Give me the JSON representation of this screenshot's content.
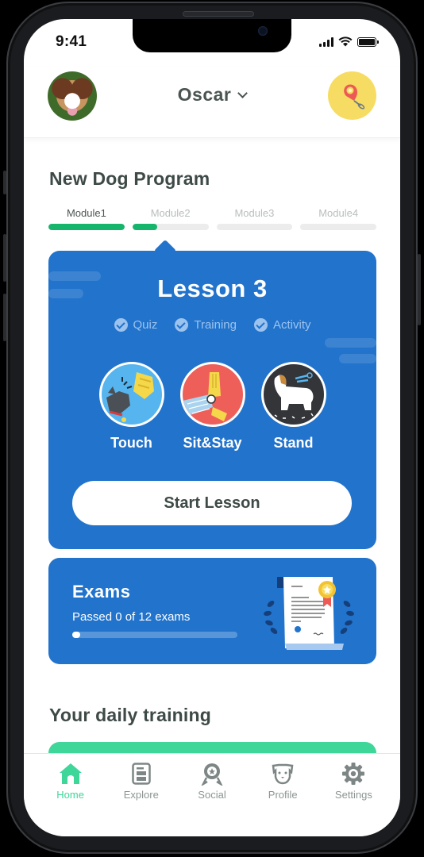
{
  "status_bar": {
    "time": "9:41"
  },
  "header": {
    "dog_name": "Oscar",
    "avatar_alt": "dog-avatar",
    "clicker_icon": "clicker-icon"
  },
  "program": {
    "title": "New Dog Program",
    "modules": [
      {
        "label": "Module1",
        "progress": 1.0,
        "active": true
      },
      {
        "label": "Module2",
        "progress": 0.33,
        "active": false
      },
      {
        "label": "Module3",
        "progress": 0.0,
        "active": false
      },
      {
        "label": "Module4",
        "progress": 0.0,
        "active": false
      }
    ]
  },
  "lesson": {
    "title": "Lesson 3",
    "tags": [
      "Quiz",
      "Training",
      "Activity"
    ],
    "skills": [
      {
        "label": "Touch",
        "icon": "touch-illustration"
      },
      {
        "label": "Sit&Stay",
        "icon": "sit-stay-illustration"
      },
      {
        "label": "Stand",
        "icon": "stand-illustration"
      }
    ],
    "start_label": "Start Lesson"
  },
  "exams": {
    "title": "Exams",
    "subtitle": "Passed 0 of 12 exams",
    "passed": 0,
    "total": 12
  },
  "daily": {
    "title": "Your daily training"
  },
  "tabbar": {
    "items": [
      {
        "label": "Home",
        "icon": "home-icon",
        "active": true
      },
      {
        "label": "Explore",
        "icon": "explore-icon",
        "active": false
      },
      {
        "label": "Social",
        "icon": "social-icon",
        "active": false
      },
      {
        "label": "Profile",
        "icon": "profile-icon",
        "active": false
      },
      {
        "label": "Settings",
        "icon": "settings-icon",
        "active": false
      }
    ]
  },
  "colors": {
    "accent_green": "#3fd69a",
    "progress_green": "#16b56c",
    "card_blue": "#2173cc",
    "clicker_yellow": "#f7dc63"
  }
}
